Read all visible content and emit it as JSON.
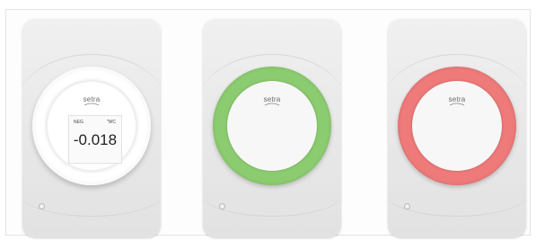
{
  "devices": [
    {
      "state": "display",
      "ring_color": "#ffffff",
      "brand": "setra",
      "screen": {
        "left_label": "NEG",
        "right_label": "\"WC",
        "value": "-0.018"
      }
    },
    {
      "state": "normal",
      "ring_color": "#8ccc70",
      "brand": "setra"
    },
    {
      "state": "alarm",
      "ring_color": "#ee7a7a",
      "brand": "setra"
    }
  ]
}
